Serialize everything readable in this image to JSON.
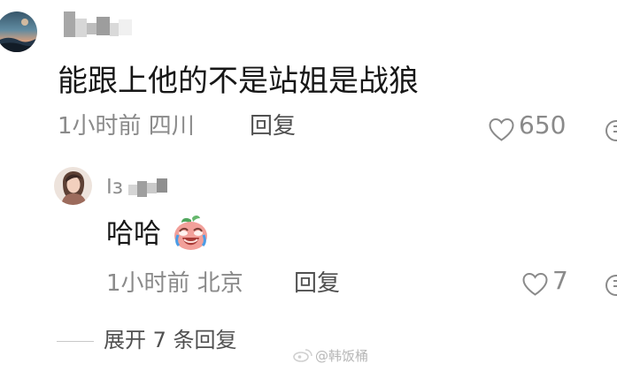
{
  "comment": {
    "username": "",
    "content": "能跟上他的不是站姐是战狼",
    "time_location": "1小时前 四川",
    "reply_label": "回复",
    "likes": "650",
    "heart_icon": "heart-outline-icon",
    "avatar_colors": {
      "sky": "#2b4d63",
      "sea": "#5d8ca3",
      "sunset": "#d9826a"
    }
  },
  "reply": {
    "username": "",
    "content": "哈哈",
    "emoji_icon": "crying-laughing-emoji-icon",
    "time_location": "1小时前 北京",
    "reply_label": "回复",
    "likes": "7",
    "heart_icon": "heart-outline-icon"
  },
  "more_replies": {
    "label": "展开 7 条回复"
  },
  "watermark": {
    "text": "@韩饭桶"
  },
  "colors": {
    "text_primary": "#171717",
    "text_meta": "#8a8a8a",
    "text_reply": "#505050",
    "divider": "#c8c8c8",
    "emoji_face": "#f2a09a",
    "emoji_leaf": "#66b86d"
  }
}
